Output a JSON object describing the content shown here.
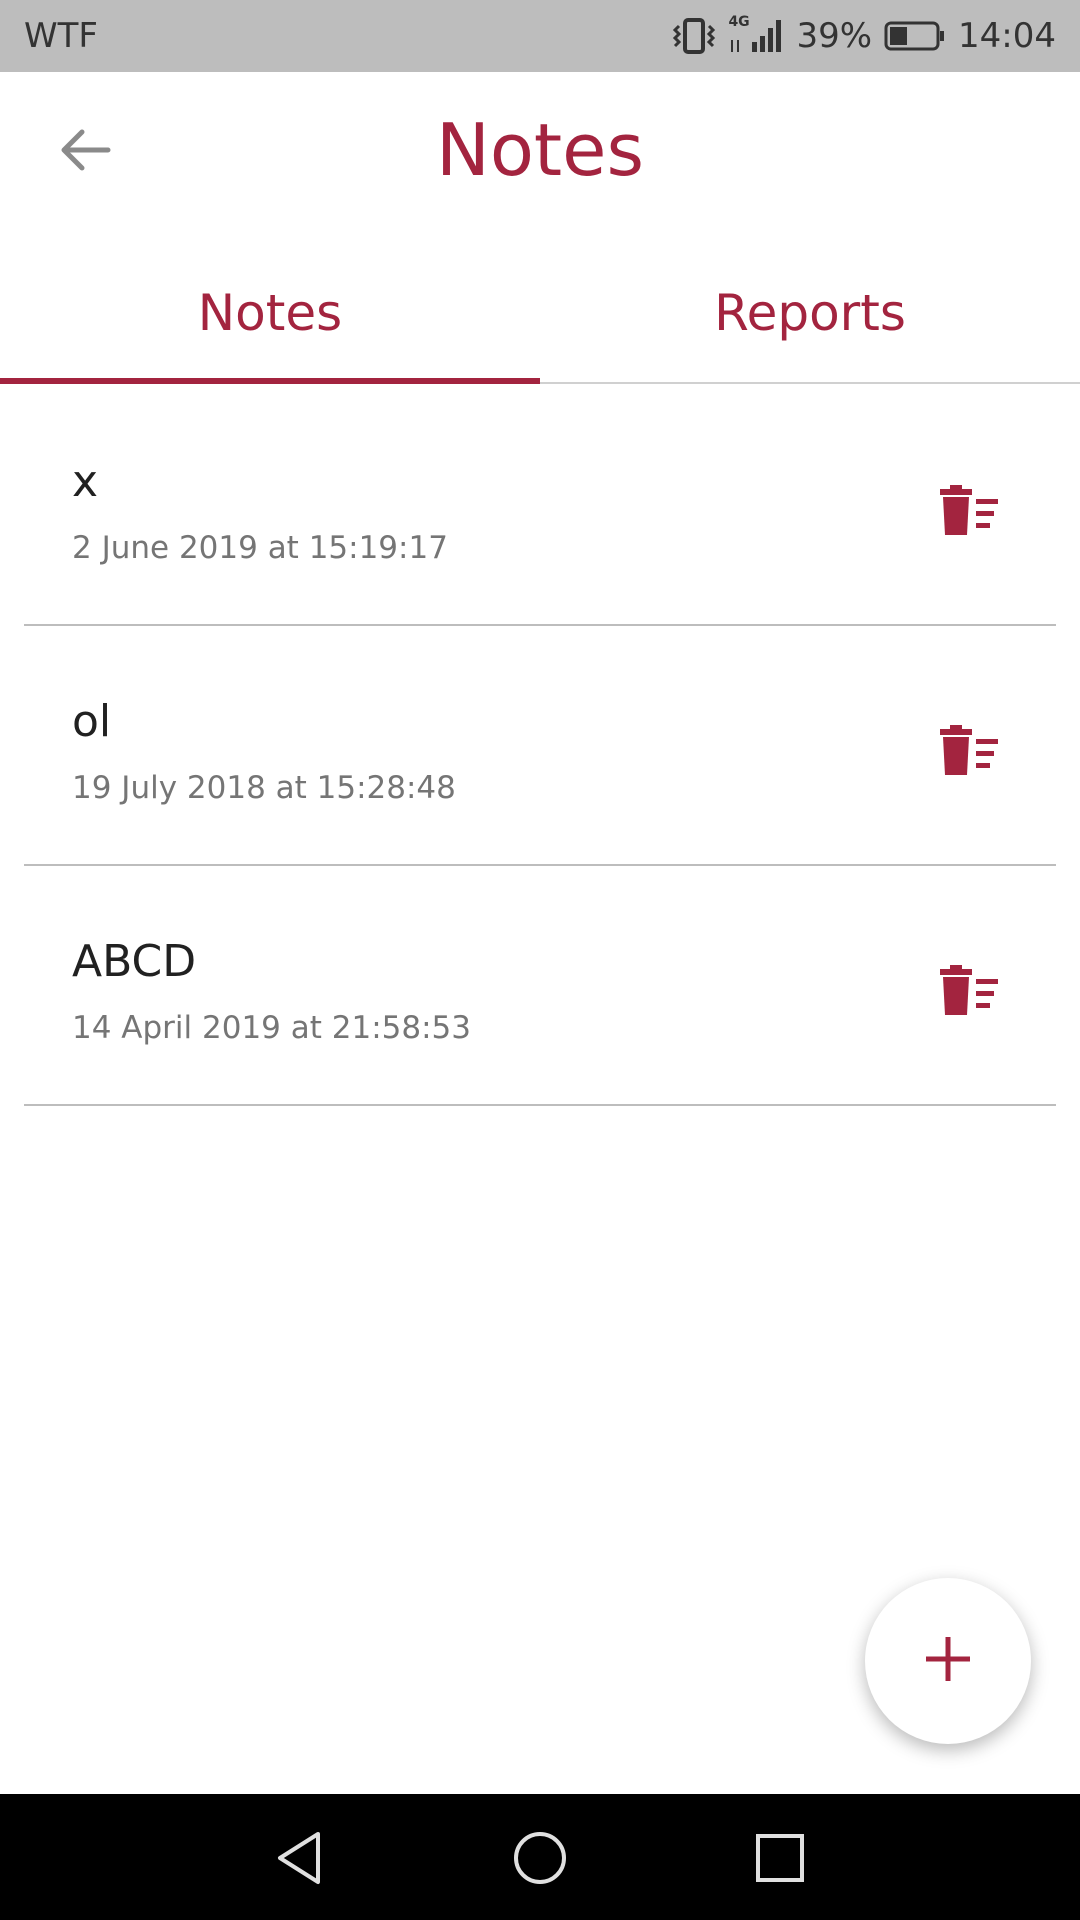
{
  "status_bar": {
    "carrier": "WTF",
    "network": "4G",
    "battery": "39%",
    "battery_level": 0.39,
    "time": "14:04"
  },
  "header": {
    "title": "Notes",
    "back_icon": "arrow-left-icon"
  },
  "tabs": [
    {
      "label": "Notes",
      "selected": true
    },
    {
      "label": "Reports",
      "selected": false
    }
  ],
  "notes": [
    {
      "title": "x",
      "date": "2 June 2019 at 15:19:17"
    },
    {
      "title": "ol",
      "date": "19 July 2018 at 15:28:48"
    },
    {
      "title": "ABCD",
      "date": "14 April 2019 at 21:58:53"
    }
  ],
  "icons": {
    "delete": "delete-sweep-icon",
    "fab": "plus-icon"
  },
  "colors": {
    "accent": "#a3243f",
    "status_bar_bg": "#bdbdbd",
    "nav_bar_bg": "#000000"
  }
}
